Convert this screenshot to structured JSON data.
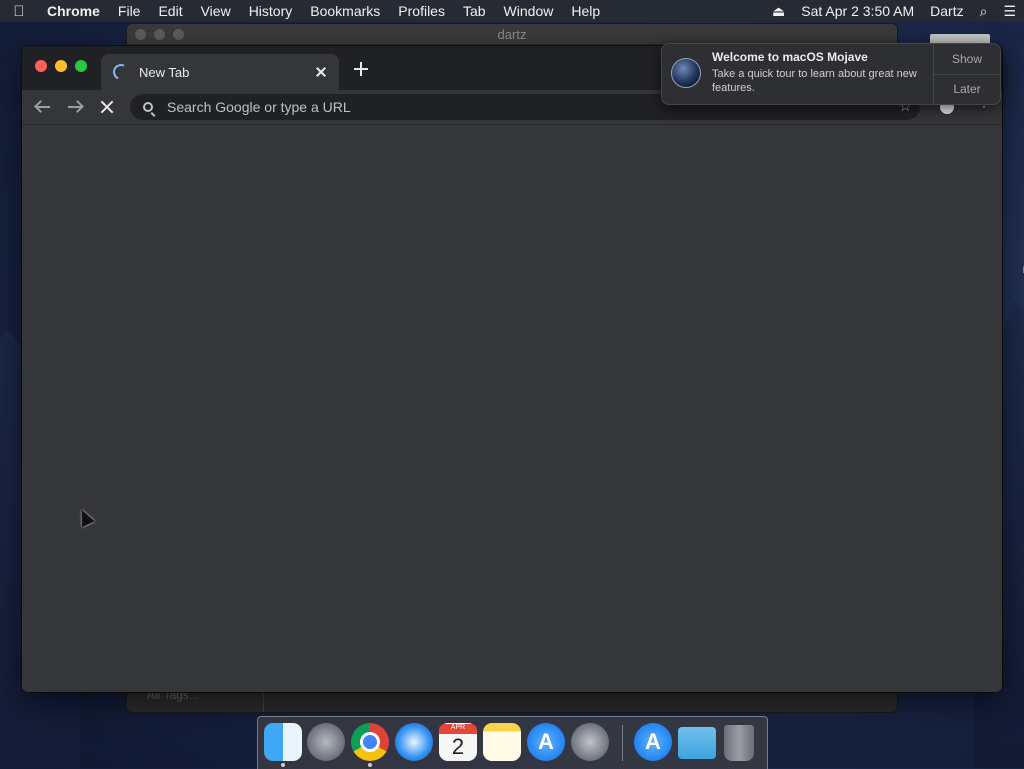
{
  "menubar": {
    "apple_icon": "",
    "app_name": "Chrome",
    "items": [
      "File",
      "Edit",
      "View",
      "History",
      "Bookmarks",
      "Profiles",
      "Tab",
      "Window",
      "Help"
    ],
    "eject_icon": "⏏",
    "clock": "Sat Apr 2  3:50 AM",
    "user": "Dartz",
    "search_icon": "⌕",
    "menu_icon": "☰"
  },
  "background_window": {
    "title": "dartz",
    "sidebar_text": "All Tags..."
  },
  "desktop": {
    "item_label": "n"
  },
  "browser": {
    "tab_title": "New Tab",
    "omnibox_placeholder": "Search Google or type a URL",
    "star_icon": "☆",
    "kebab_icon": "⋮"
  },
  "notification": {
    "title": "Welcome to macOS Mojave",
    "body": "Take a quick tour to learn about great new features.",
    "show_label": "Show",
    "later_label": "Later"
  },
  "dock": {
    "calendar_month": "APR",
    "calendar_day": "2",
    "appstore_glyph": "A",
    "icons": [
      "finder-icon",
      "launchpad-icon",
      "chrome-icon",
      "safari-icon",
      "calendar-icon",
      "notes-icon",
      "app-store-icon",
      "system-preferences-icon",
      "app-store-icon",
      "downloads-folder-icon",
      "trash-icon"
    ]
  },
  "colors": {
    "browser_bg": "#35363a",
    "tabstrip_bg": "#202124",
    "menubar_bg": "#262a33",
    "loading_spinner": "#8ab4f8"
  }
}
